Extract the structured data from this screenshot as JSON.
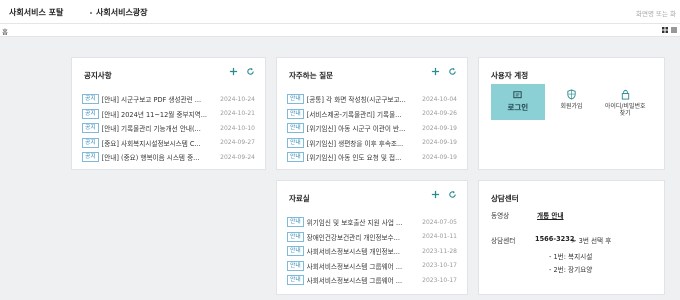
{
  "header": {
    "portal_title": "사회서비스 포탈",
    "breadcrumb": "사회서비스광장",
    "search_hint": "화면명 또는 화"
  },
  "subbar": {
    "home": "홈"
  },
  "notice": {
    "title": "공지사항",
    "items": [
      {
        "tag": "공지",
        "text": "[안내] 시군구보고 PDF 생성관련 ...",
        "date": "2024-10-24"
      },
      {
        "tag": "공지",
        "text": "[안내] 2024년 11~12월 중부지역...",
        "date": "2024-10-21"
      },
      {
        "tag": "공지",
        "text": "[안내] 기록물관리 기능개선 안내(...",
        "date": "2024-10-10"
      },
      {
        "tag": "공지",
        "text": "[중요] 사회복지시설정보시스템 C...",
        "date": "2024-09-27"
      },
      {
        "tag": "공지",
        "text": "[안내] (중요) 행복이음 시스템 중...",
        "date": "2024-09-24"
      }
    ]
  },
  "faq": {
    "title": "자주하는 질문",
    "items": [
      {
        "tag": "안내",
        "text": "[공통] 각 화면 작성칭(시군구보고...",
        "date": "2024-10-04"
      },
      {
        "tag": "안내",
        "text": "[서비스제공-기록물관리] 기록물...",
        "date": "2024-09-26"
      },
      {
        "tag": "안내",
        "text": "[위기임신] 아동 시군구 이관이 반...",
        "date": "2024-09-19"
      },
      {
        "tag": "안내",
        "text": "[위기임신] 생편창을 이후 후속조...",
        "date": "2024-09-19"
      },
      {
        "tag": "안내",
        "text": "[위기임신] 아동 인도 요청 및 접...",
        "date": "2024-09-19"
      }
    ]
  },
  "account": {
    "title": "사용자 계정",
    "login": "로그인",
    "signup": "회원가입",
    "find": "아이디/비밀번호 찾기"
  },
  "archive": {
    "title": "자료실",
    "items": [
      {
        "tag": "안내",
        "text": "위기임신 및 보호출산 지원 사업 ...",
        "date": "2024-07-05"
      },
      {
        "tag": "안내",
        "text": "장애인건강보건관리 개인정보수...",
        "date": "2024-01-11"
      },
      {
        "tag": "안내",
        "text": "사회서비스정보시스템 개인정보...",
        "date": "2023-11-28"
      },
      {
        "tag": "안내",
        "text": "사회서비스정보시스템 그룹웨어 ...",
        "date": "2023-10-17"
      },
      {
        "tag": "안내",
        "text": "사회서비스정보시스템 그룹웨어 ...",
        "date": "2023-10-17"
      }
    ]
  },
  "support": {
    "title": "상담센터",
    "video_label": "동영상",
    "video_link": "개통 안내",
    "center_label": "상담센터",
    "phone": "1566-3232",
    "guide": "> 3번 선택 후",
    "opt1": "- 1번: 복지시설",
    "opt2": "- 2번: 장기요양"
  },
  "colors": {
    "accent_teal": "#8bd0d4",
    "badge_blue": "#2a87b8",
    "action_teal": "#2a8a8f"
  }
}
